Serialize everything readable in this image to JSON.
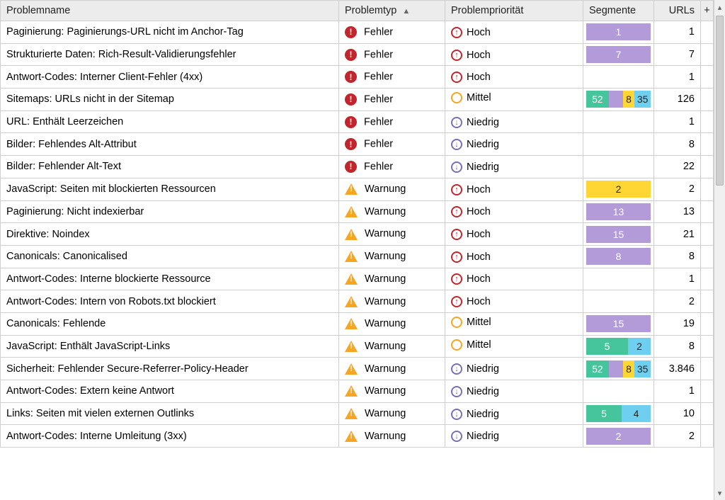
{
  "columns": {
    "name": "Problemname",
    "type": "Problemtyp",
    "prio": "Problempriorität",
    "seg": "Segmente",
    "urls": "URLs"
  },
  "typeLabels": {
    "error": "Fehler",
    "warn": "Warnung"
  },
  "prioLabels": {
    "high": "Hoch",
    "medium": "Mittel",
    "low": "Niedrig"
  },
  "segColors": {
    "purple": "c-purple",
    "green": "c-green",
    "yellow": "c-yellow",
    "blue": "c-blue"
  },
  "rows": [
    {
      "name": "Paginierung: Paginierungs-URL nicht im Anchor-Tag",
      "type": "error",
      "prio": "high",
      "segments": [
        {
          "c": "purple",
          "v": 1,
          "w": 100
        }
      ],
      "urls": "1"
    },
    {
      "name": "Strukturierte Daten: Rich-Result-Validierungsfehler",
      "type": "error",
      "prio": "high",
      "segments": [
        {
          "c": "purple",
          "v": 7,
          "w": 100
        }
      ],
      "urls": "7"
    },
    {
      "name": "Antwort-Codes: Interner Client-Fehler (4xx)",
      "type": "error",
      "prio": "high",
      "segments": [],
      "urls": "1"
    },
    {
      "name": "Sitemaps: URLs nicht in der Sitemap",
      "type": "error",
      "prio": "medium",
      "segments": [
        {
          "c": "green",
          "v": 52,
          "w": 35
        },
        {
          "c": "purple",
          "v": "",
          "w": 22
        },
        {
          "c": "yellow",
          "v": 8,
          "w": 18,
          "dark": true
        },
        {
          "c": "blue",
          "v": 35,
          "w": 25,
          "dark": true
        }
      ],
      "urls": "126"
    },
    {
      "name": "URL: Enthält Leerzeichen",
      "type": "error",
      "prio": "low",
      "segments": [],
      "urls": "1"
    },
    {
      "name": "Bilder: Fehlendes Alt-Attribut",
      "type": "error",
      "prio": "low",
      "segments": [],
      "urls": "8"
    },
    {
      "name": "Bilder: Fehlender Alt-Text",
      "type": "error",
      "prio": "low",
      "segments": [],
      "urls": "22"
    },
    {
      "name": "JavaScript: Seiten mit blockierten Ressourcen",
      "type": "warn",
      "prio": "high",
      "segments": [
        {
          "c": "yellow",
          "v": 2,
          "w": 100,
          "dark": true
        }
      ],
      "urls": "2"
    },
    {
      "name": "Paginierung: Nicht indexierbar",
      "type": "warn",
      "prio": "high",
      "segments": [
        {
          "c": "purple",
          "v": 13,
          "w": 100
        }
      ],
      "urls": "13"
    },
    {
      "name": "Direktive: Noindex",
      "type": "warn",
      "prio": "high",
      "segments": [
        {
          "c": "purple",
          "v": 15,
          "w": 100
        }
      ],
      "urls": "21"
    },
    {
      "name": "Canonicals: Canonicalised",
      "type": "warn",
      "prio": "high",
      "segments": [
        {
          "c": "purple",
          "v": 8,
          "w": 100
        }
      ],
      "urls": "8"
    },
    {
      "name": "Antwort-Codes: Interne blockierte Ressource",
      "type": "warn",
      "prio": "high",
      "segments": [],
      "urls": "1"
    },
    {
      "name": "Antwort-Codes: Intern von Robots.txt blockiert",
      "type": "warn",
      "prio": "high",
      "segments": [],
      "urls": "2"
    },
    {
      "name": "Canonicals: Fehlende",
      "type": "warn",
      "prio": "medium",
      "segments": [
        {
          "c": "purple",
          "v": 15,
          "w": 100
        }
      ],
      "urls": "19"
    },
    {
      "name": "JavaScript: Enthält JavaScript-Links",
      "type": "warn",
      "prio": "medium",
      "segments": [
        {
          "c": "green",
          "v": 5,
          "w": 65
        },
        {
          "c": "blue",
          "v": 2,
          "w": 35,
          "dark": true
        }
      ],
      "urls": "8"
    },
    {
      "name": "Sicherheit: Fehlender Secure-Referrer-Policy-Header",
      "type": "warn",
      "prio": "low",
      "segments": [
        {
          "c": "green",
          "v": 52,
          "w": 35
        },
        {
          "c": "purple",
          "v": "",
          "w": 22
        },
        {
          "c": "yellow",
          "v": 8,
          "w": 18,
          "dark": true
        },
        {
          "c": "blue",
          "v": 35,
          "w": 25,
          "dark": true
        }
      ],
      "urls": "3.846"
    },
    {
      "name": "Antwort-Codes: Extern keine Antwort",
      "type": "warn",
      "prio": "low",
      "segments": [],
      "urls": "1"
    },
    {
      "name": "Links: Seiten mit vielen externen Outlinks",
      "type": "warn",
      "prio": "low",
      "segments": [
        {
          "c": "green",
          "v": 5,
          "w": 55
        },
        {
          "c": "blue",
          "v": 4,
          "w": 45,
          "dark": true
        }
      ],
      "urls": "10"
    },
    {
      "name": "Antwort-Codes: Interne Umleitung (3xx)",
      "type": "warn",
      "prio": "low",
      "segments": [
        {
          "c": "purple",
          "v": 2,
          "w": 100
        }
      ],
      "urls": "2"
    }
  ]
}
